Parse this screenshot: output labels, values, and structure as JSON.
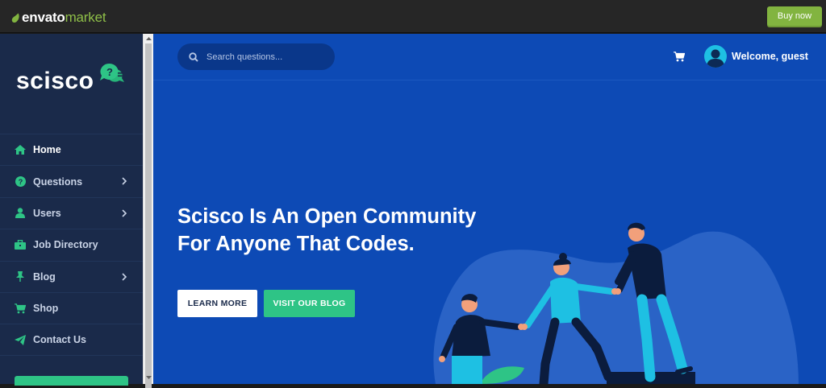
{
  "envato": {
    "logo_envato": "envato",
    "logo_market": "market",
    "buy_now": "Buy now"
  },
  "sidebar": {
    "brand": "scisco",
    "items": [
      {
        "label": "Home",
        "icon": "home-icon",
        "active": true,
        "has_children": false
      },
      {
        "label": "Questions",
        "icon": "question-circle-icon",
        "active": false,
        "has_children": true
      },
      {
        "label": "Users",
        "icon": "user-icon",
        "active": false,
        "has_children": true
      },
      {
        "label": "Job Directory",
        "icon": "briefcase-icon",
        "active": false,
        "has_children": false
      },
      {
        "label": "Blog",
        "icon": "pin-icon",
        "active": false,
        "has_children": true
      },
      {
        "label": "Shop",
        "icon": "cart-icon",
        "active": false,
        "has_children": false
      },
      {
        "label": "Contact Us",
        "icon": "paper-plane-icon",
        "active": false,
        "has_children": false
      }
    ]
  },
  "header": {
    "search_placeholder": "Search questions...",
    "welcome": "Welcome, guest"
  },
  "hero": {
    "title_line1": "Scisco Is An Open Community",
    "title_line2": "For Anyone That Codes.",
    "learn_more": "LEARN MORE",
    "visit_blog": "VISIT OUR BLOG"
  },
  "colors": {
    "main_bg": "#0d4ab5",
    "sidebar_bg": "#1a2a4a",
    "accent_green": "#2ec486",
    "envato_green": "#82b440",
    "icon_green": "#2ec486"
  }
}
